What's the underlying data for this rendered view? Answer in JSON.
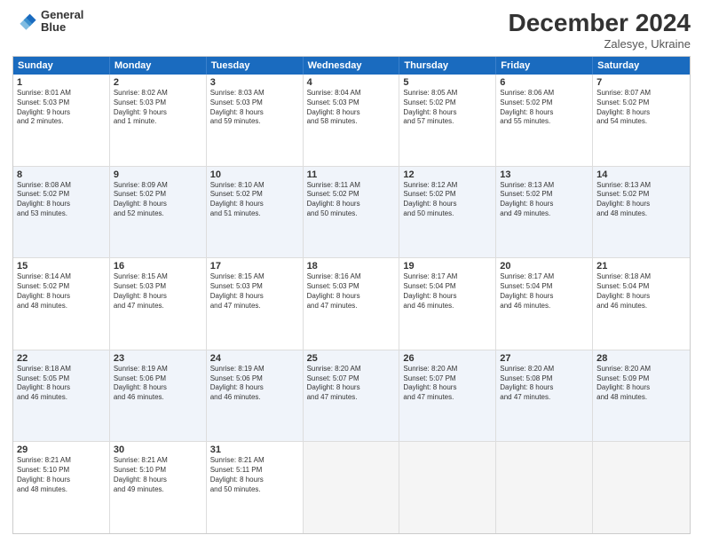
{
  "header": {
    "logo_line1": "General",
    "logo_line2": "Blue",
    "title": "December 2024",
    "subtitle": "Zalesye, Ukraine"
  },
  "days_of_week": [
    "Sunday",
    "Monday",
    "Tuesday",
    "Wednesday",
    "Thursday",
    "Friday",
    "Saturday"
  ],
  "rows": [
    [
      {
        "num": "1",
        "info": "Sunrise: 8:01 AM\nSunset: 5:03 PM\nDaylight: 9 hours\nand 2 minutes."
      },
      {
        "num": "2",
        "info": "Sunrise: 8:02 AM\nSunset: 5:03 PM\nDaylight: 9 hours\nand 1 minute."
      },
      {
        "num": "3",
        "info": "Sunrise: 8:03 AM\nSunset: 5:03 PM\nDaylight: 8 hours\nand 59 minutes."
      },
      {
        "num": "4",
        "info": "Sunrise: 8:04 AM\nSunset: 5:03 PM\nDaylight: 8 hours\nand 58 minutes."
      },
      {
        "num": "5",
        "info": "Sunrise: 8:05 AM\nSunset: 5:02 PM\nDaylight: 8 hours\nand 57 minutes."
      },
      {
        "num": "6",
        "info": "Sunrise: 8:06 AM\nSunset: 5:02 PM\nDaylight: 8 hours\nand 55 minutes."
      },
      {
        "num": "7",
        "info": "Sunrise: 8:07 AM\nSunset: 5:02 PM\nDaylight: 8 hours\nand 54 minutes."
      }
    ],
    [
      {
        "num": "8",
        "info": "Sunrise: 8:08 AM\nSunset: 5:02 PM\nDaylight: 8 hours\nand 53 minutes."
      },
      {
        "num": "9",
        "info": "Sunrise: 8:09 AM\nSunset: 5:02 PM\nDaylight: 8 hours\nand 52 minutes."
      },
      {
        "num": "10",
        "info": "Sunrise: 8:10 AM\nSunset: 5:02 PM\nDaylight: 8 hours\nand 51 minutes."
      },
      {
        "num": "11",
        "info": "Sunrise: 8:11 AM\nSunset: 5:02 PM\nDaylight: 8 hours\nand 50 minutes."
      },
      {
        "num": "12",
        "info": "Sunrise: 8:12 AM\nSunset: 5:02 PM\nDaylight: 8 hours\nand 50 minutes."
      },
      {
        "num": "13",
        "info": "Sunrise: 8:13 AM\nSunset: 5:02 PM\nDaylight: 8 hours\nand 49 minutes."
      },
      {
        "num": "14",
        "info": "Sunrise: 8:13 AM\nSunset: 5:02 PM\nDaylight: 8 hours\nand 48 minutes."
      }
    ],
    [
      {
        "num": "15",
        "info": "Sunrise: 8:14 AM\nSunset: 5:02 PM\nDaylight: 8 hours\nand 48 minutes."
      },
      {
        "num": "16",
        "info": "Sunrise: 8:15 AM\nSunset: 5:03 PM\nDaylight: 8 hours\nand 47 minutes."
      },
      {
        "num": "17",
        "info": "Sunrise: 8:15 AM\nSunset: 5:03 PM\nDaylight: 8 hours\nand 47 minutes."
      },
      {
        "num": "18",
        "info": "Sunrise: 8:16 AM\nSunset: 5:03 PM\nDaylight: 8 hours\nand 47 minutes."
      },
      {
        "num": "19",
        "info": "Sunrise: 8:17 AM\nSunset: 5:04 PM\nDaylight: 8 hours\nand 46 minutes."
      },
      {
        "num": "20",
        "info": "Sunrise: 8:17 AM\nSunset: 5:04 PM\nDaylight: 8 hours\nand 46 minutes."
      },
      {
        "num": "21",
        "info": "Sunrise: 8:18 AM\nSunset: 5:04 PM\nDaylight: 8 hours\nand 46 minutes."
      }
    ],
    [
      {
        "num": "22",
        "info": "Sunrise: 8:18 AM\nSunset: 5:05 PM\nDaylight: 8 hours\nand 46 minutes."
      },
      {
        "num": "23",
        "info": "Sunrise: 8:19 AM\nSunset: 5:06 PM\nDaylight: 8 hours\nand 46 minutes."
      },
      {
        "num": "24",
        "info": "Sunrise: 8:19 AM\nSunset: 5:06 PM\nDaylight: 8 hours\nand 46 minutes."
      },
      {
        "num": "25",
        "info": "Sunrise: 8:20 AM\nSunset: 5:07 PM\nDaylight: 8 hours\nand 47 minutes."
      },
      {
        "num": "26",
        "info": "Sunrise: 8:20 AM\nSunset: 5:07 PM\nDaylight: 8 hours\nand 47 minutes."
      },
      {
        "num": "27",
        "info": "Sunrise: 8:20 AM\nSunset: 5:08 PM\nDaylight: 8 hours\nand 47 minutes."
      },
      {
        "num": "28",
        "info": "Sunrise: 8:20 AM\nSunset: 5:09 PM\nDaylight: 8 hours\nand 48 minutes."
      }
    ],
    [
      {
        "num": "29",
        "info": "Sunrise: 8:21 AM\nSunset: 5:10 PM\nDaylight: 8 hours\nand 48 minutes."
      },
      {
        "num": "30",
        "info": "Sunrise: 8:21 AM\nSunset: 5:10 PM\nDaylight: 8 hours\nand 49 minutes."
      },
      {
        "num": "31",
        "info": "Sunrise: 8:21 AM\nSunset: 5:11 PM\nDaylight: 8 hours\nand 50 minutes."
      },
      null,
      null,
      null,
      null
    ]
  ]
}
